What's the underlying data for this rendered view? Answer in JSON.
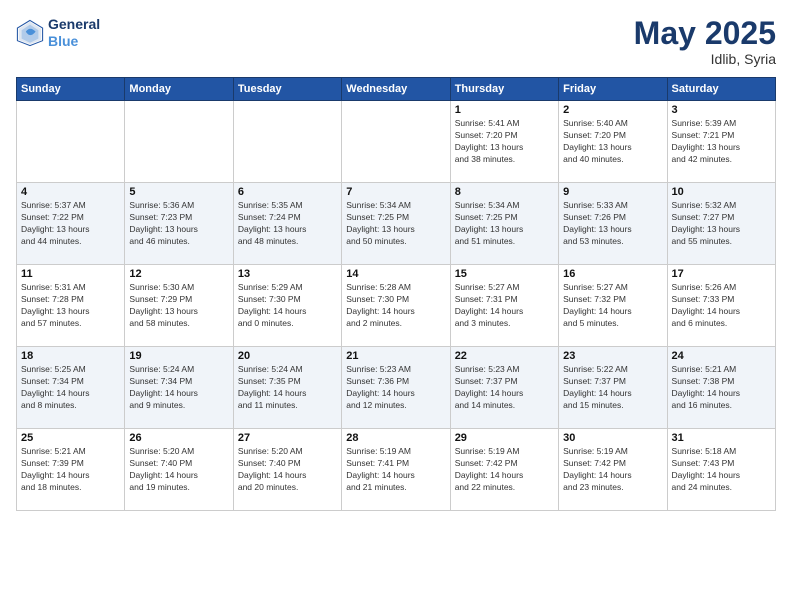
{
  "header": {
    "logo_line1": "General",
    "logo_line2": "Blue",
    "month": "May 2025",
    "location": "Idlib, Syria"
  },
  "weekdays": [
    "Sunday",
    "Monday",
    "Tuesday",
    "Wednesday",
    "Thursday",
    "Friday",
    "Saturday"
  ],
  "weeks": [
    [
      {
        "day": "",
        "info": ""
      },
      {
        "day": "",
        "info": ""
      },
      {
        "day": "",
        "info": ""
      },
      {
        "day": "",
        "info": ""
      },
      {
        "day": "1",
        "info": "Sunrise: 5:41 AM\nSunset: 7:20 PM\nDaylight: 13 hours\nand 38 minutes."
      },
      {
        "day": "2",
        "info": "Sunrise: 5:40 AM\nSunset: 7:20 PM\nDaylight: 13 hours\nand 40 minutes."
      },
      {
        "day": "3",
        "info": "Sunrise: 5:39 AM\nSunset: 7:21 PM\nDaylight: 13 hours\nand 42 minutes."
      }
    ],
    [
      {
        "day": "4",
        "info": "Sunrise: 5:37 AM\nSunset: 7:22 PM\nDaylight: 13 hours\nand 44 minutes."
      },
      {
        "day": "5",
        "info": "Sunrise: 5:36 AM\nSunset: 7:23 PM\nDaylight: 13 hours\nand 46 minutes."
      },
      {
        "day": "6",
        "info": "Sunrise: 5:35 AM\nSunset: 7:24 PM\nDaylight: 13 hours\nand 48 minutes."
      },
      {
        "day": "7",
        "info": "Sunrise: 5:34 AM\nSunset: 7:25 PM\nDaylight: 13 hours\nand 50 minutes."
      },
      {
        "day": "8",
        "info": "Sunrise: 5:34 AM\nSunset: 7:25 PM\nDaylight: 13 hours\nand 51 minutes."
      },
      {
        "day": "9",
        "info": "Sunrise: 5:33 AM\nSunset: 7:26 PM\nDaylight: 13 hours\nand 53 minutes."
      },
      {
        "day": "10",
        "info": "Sunrise: 5:32 AM\nSunset: 7:27 PM\nDaylight: 13 hours\nand 55 minutes."
      }
    ],
    [
      {
        "day": "11",
        "info": "Sunrise: 5:31 AM\nSunset: 7:28 PM\nDaylight: 13 hours\nand 57 minutes."
      },
      {
        "day": "12",
        "info": "Sunrise: 5:30 AM\nSunset: 7:29 PM\nDaylight: 13 hours\nand 58 minutes."
      },
      {
        "day": "13",
        "info": "Sunrise: 5:29 AM\nSunset: 7:30 PM\nDaylight: 14 hours\nand 0 minutes."
      },
      {
        "day": "14",
        "info": "Sunrise: 5:28 AM\nSunset: 7:30 PM\nDaylight: 14 hours\nand 2 minutes."
      },
      {
        "day": "15",
        "info": "Sunrise: 5:27 AM\nSunset: 7:31 PM\nDaylight: 14 hours\nand 3 minutes."
      },
      {
        "day": "16",
        "info": "Sunrise: 5:27 AM\nSunset: 7:32 PM\nDaylight: 14 hours\nand 5 minutes."
      },
      {
        "day": "17",
        "info": "Sunrise: 5:26 AM\nSunset: 7:33 PM\nDaylight: 14 hours\nand 6 minutes."
      }
    ],
    [
      {
        "day": "18",
        "info": "Sunrise: 5:25 AM\nSunset: 7:34 PM\nDaylight: 14 hours\nand 8 minutes."
      },
      {
        "day": "19",
        "info": "Sunrise: 5:24 AM\nSunset: 7:34 PM\nDaylight: 14 hours\nand 9 minutes."
      },
      {
        "day": "20",
        "info": "Sunrise: 5:24 AM\nSunset: 7:35 PM\nDaylight: 14 hours\nand 11 minutes."
      },
      {
        "day": "21",
        "info": "Sunrise: 5:23 AM\nSunset: 7:36 PM\nDaylight: 14 hours\nand 12 minutes."
      },
      {
        "day": "22",
        "info": "Sunrise: 5:23 AM\nSunset: 7:37 PM\nDaylight: 14 hours\nand 14 minutes."
      },
      {
        "day": "23",
        "info": "Sunrise: 5:22 AM\nSunset: 7:37 PM\nDaylight: 14 hours\nand 15 minutes."
      },
      {
        "day": "24",
        "info": "Sunrise: 5:21 AM\nSunset: 7:38 PM\nDaylight: 14 hours\nand 16 minutes."
      }
    ],
    [
      {
        "day": "25",
        "info": "Sunrise: 5:21 AM\nSunset: 7:39 PM\nDaylight: 14 hours\nand 18 minutes."
      },
      {
        "day": "26",
        "info": "Sunrise: 5:20 AM\nSunset: 7:40 PM\nDaylight: 14 hours\nand 19 minutes."
      },
      {
        "day": "27",
        "info": "Sunrise: 5:20 AM\nSunset: 7:40 PM\nDaylight: 14 hours\nand 20 minutes."
      },
      {
        "day": "28",
        "info": "Sunrise: 5:19 AM\nSunset: 7:41 PM\nDaylight: 14 hours\nand 21 minutes."
      },
      {
        "day": "29",
        "info": "Sunrise: 5:19 AM\nSunset: 7:42 PM\nDaylight: 14 hours\nand 22 minutes."
      },
      {
        "day": "30",
        "info": "Sunrise: 5:19 AM\nSunset: 7:42 PM\nDaylight: 14 hours\nand 23 minutes."
      },
      {
        "day": "31",
        "info": "Sunrise: 5:18 AM\nSunset: 7:43 PM\nDaylight: 14 hours\nand 24 minutes."
      }
    ]
  ]
}
